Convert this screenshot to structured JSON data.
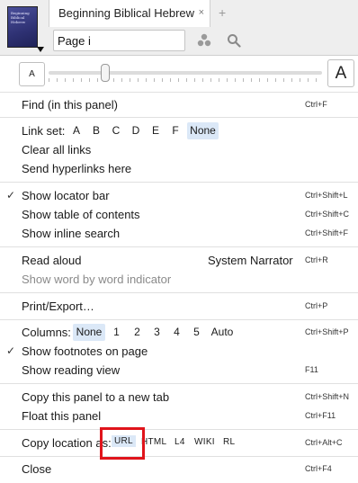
{
  "header": {
    "cover_title": "Beginning Biblical Hebrew",
    "tab_title": "Beginning Biblical Hebrew",
    "tab_close": "×",
    "tab_add": "+",
    "page_value": "Page i"
  },
  "zoom": {
    "small_label": "A",
    "large_label": "A",
    "level": 0.2
  },
  "menu": {
    "find": {
      "label": "Find (in this panel)",
      "shortcut": "Ctrl+F"
    },
    "link_set": {
      "label": "Link set:",
      "options": [
        "A",
        "B",
        "C",
        "D",
        "E",
        "F",
        "None"
      ],
      "selected": "None"
    },
    "clear_links": {
      "label": "Clear all links"
    },
    "send_hyperlinks": {
      "label": "Send hyperlinks here"
    },
    "show_locator": {
      "label": "Show locator bar",
      "shortcut": "Ctrl+Shift+L",
      "checked": true,
      "check_mark": "✓"
    },
    "show_toc": {
      "label": "Show table of contents",
      "shortcut": "Ctrl+Shift+C"
    },
    "show_inline_search": {
      "label": "Show inline search",
      "shortcut": "Ctrl+Shift+F"
    },
    "read_aloud": {
      "label": "Read aloud",
      "voice": "System Narrator",
      "shortcut": "Ctrl+R"
    },
    "word_indicator": {
      "label": "Show word by word indicator"
    },
    "print_export": {
      "label": "Print/Export…",
      "shortcut": "Ctrl+P"
    },
    "columns": {
      "label": "Columns:",
      "options": [
        "None",
        "1",
        "2",
        "3",
        "4",
        "5",
        "Auto"
      ],
      "selected": "None",
      "shortcut": "Ctrl+Shift+P"
    },
    "show_footnotes": {
      "label": "Show footnotes on page",
      "checked": true,
      "check_mark": "✓"
    },
    "show_reading_view": {
      "label": "Show reading view",
      "shortcut": "F11"
    },
    "copy_panel": {
      "label": "Copy this panel to a new tab",
      "shortcut": "Ctrl+Shift+N"
    },
    "float_panel": {
      "label": "Float this panel",
      "shortcut": "Ctrl+F11"
    },
    "copy_location": {
      "label": "Copy location as:",
      "options": [
        "URL",
        "HTML",
        "L4",
        "WIKI",
        "RL"
      ],
      "selected": "URL",
      "shortcut": "Ctrl+Alt+C"
    },
    "close": {
      "label": "Close",
      "shortcut": "Ctrl+F4"
    }
  },
  "colors": {
    "highlight_box": "#e0141b",
    "selected_option": "#dbe8f7"
  }
}
